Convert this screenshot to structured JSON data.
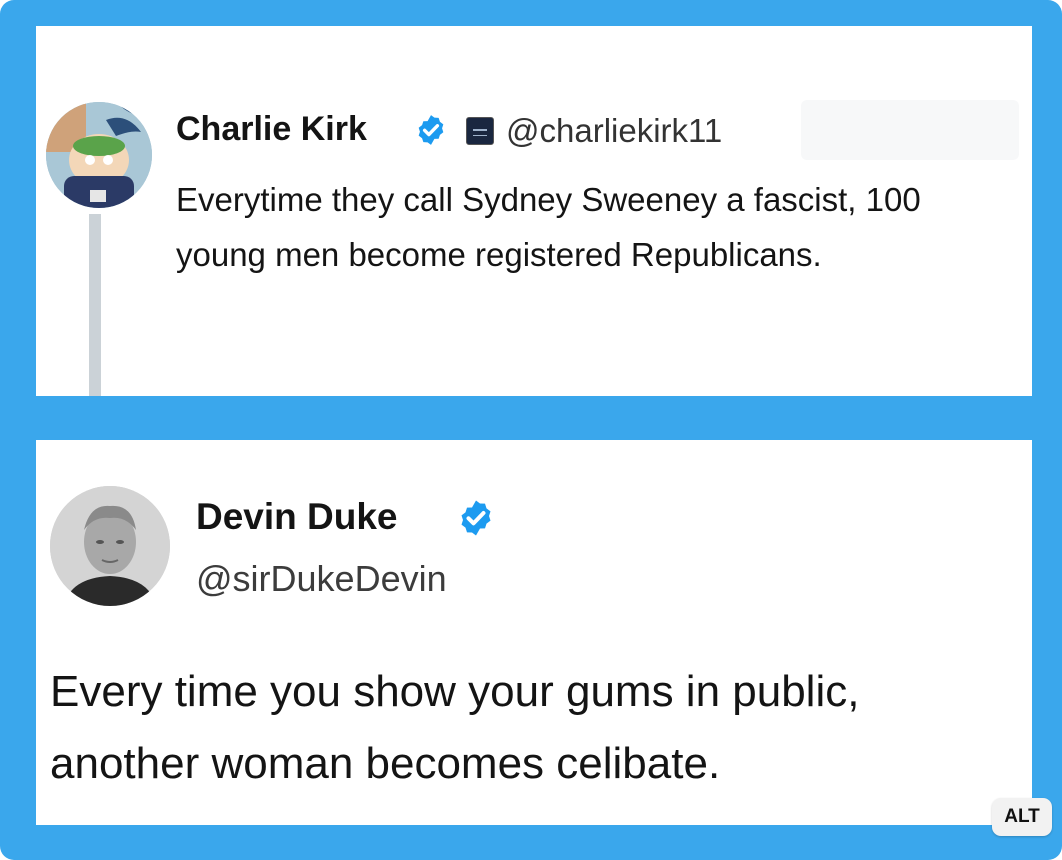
{
  "tweets": [
    {
      "name": "Charlie Kirk",
      "handle": "@charliekirk11",
      "verified": true,
      "text": "Everytime they call Sydney Sweeney a fascist, 100 young men become registered Republicans.",
      "avatar_icon": "cartoon-avatar-icon",
      "affiliation_icon": "affiliation-logo-icon"
    },
    {
      "name": "Devin Duke",
      "handle": "@sirDukeDevin",
      "verified": true,
      "text": "Every time you show your gums in public, another woman becomes celibate.",
      "avatar_icon": "profile-photo-avatar-icon"
    }
  ],
  "alt_label": "ALT",
  "colors": {
    "frame": "#3aa7ec",
    "verified_badge": "#1d9bf0",
    "text": "#141414"
  }
}
